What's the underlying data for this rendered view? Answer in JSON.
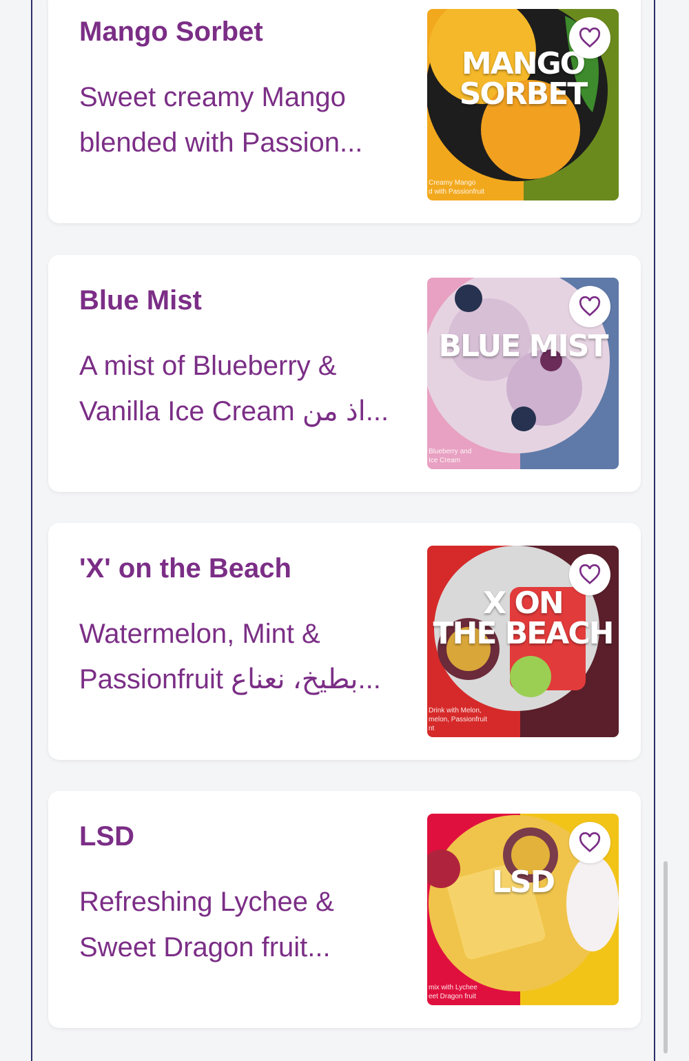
{
  "products": [
    {
      "title": "Mango Sorbet",
      "description": "Sweet creamy Mango blended with Passion...",
      "image_banner": "MANGO\nSORBET",
      "image_caption": "Creamy Mango\nd with Passionfruit",
      "colors": {
        "left": "#f2a81d",
        "right": "#6b8a1e",
        "circle": "#f5b82a"
      }
    },
    {
      "title": "Blue Mist",
      "description": "A mist of Blueberry & Vanilla Ice Cream اذ من...",
      "image_banner": "BLUE MIST",
      "image_caption": "Blueberry and\nIce Cream",
      "colors": {
        "left": "#e8a1c2",
        "right": "#5f7aa8",
        "circle": "#d9c6dc"
      }
    },
    {
      "title": "'X' on the Beach",
      "description": "Watermelon, Mint & Passionfruit بطيخ، نعناع...",
      "image_banner": "X ON\nTHE BEACH",
      "image_caption": "Drink with Melon,\nmelon, Passionfruit\nnt",
      "colors": {
        "left": "#d62a2a",
        "right": "#5a1f2a",
        "circle": "#c8c8c8"
      }
    },
    {
      "title": "LSD",
      "description": "Refreshing Lychee & Sweet Dragon fruit...",
      "image_banner": "LSD",
      "image_caption": "mix with Lychee\neet Dragon fruit",
      "colors": {
        "left": "#e0103e",
        "right": "#f2c418",
        "circle": "#f0c44a"
      }
    }
  ],
  "icons": {
    "favorite": "heart-outline-icon"
  },
  "accent_color": "#7b2e86"
}
